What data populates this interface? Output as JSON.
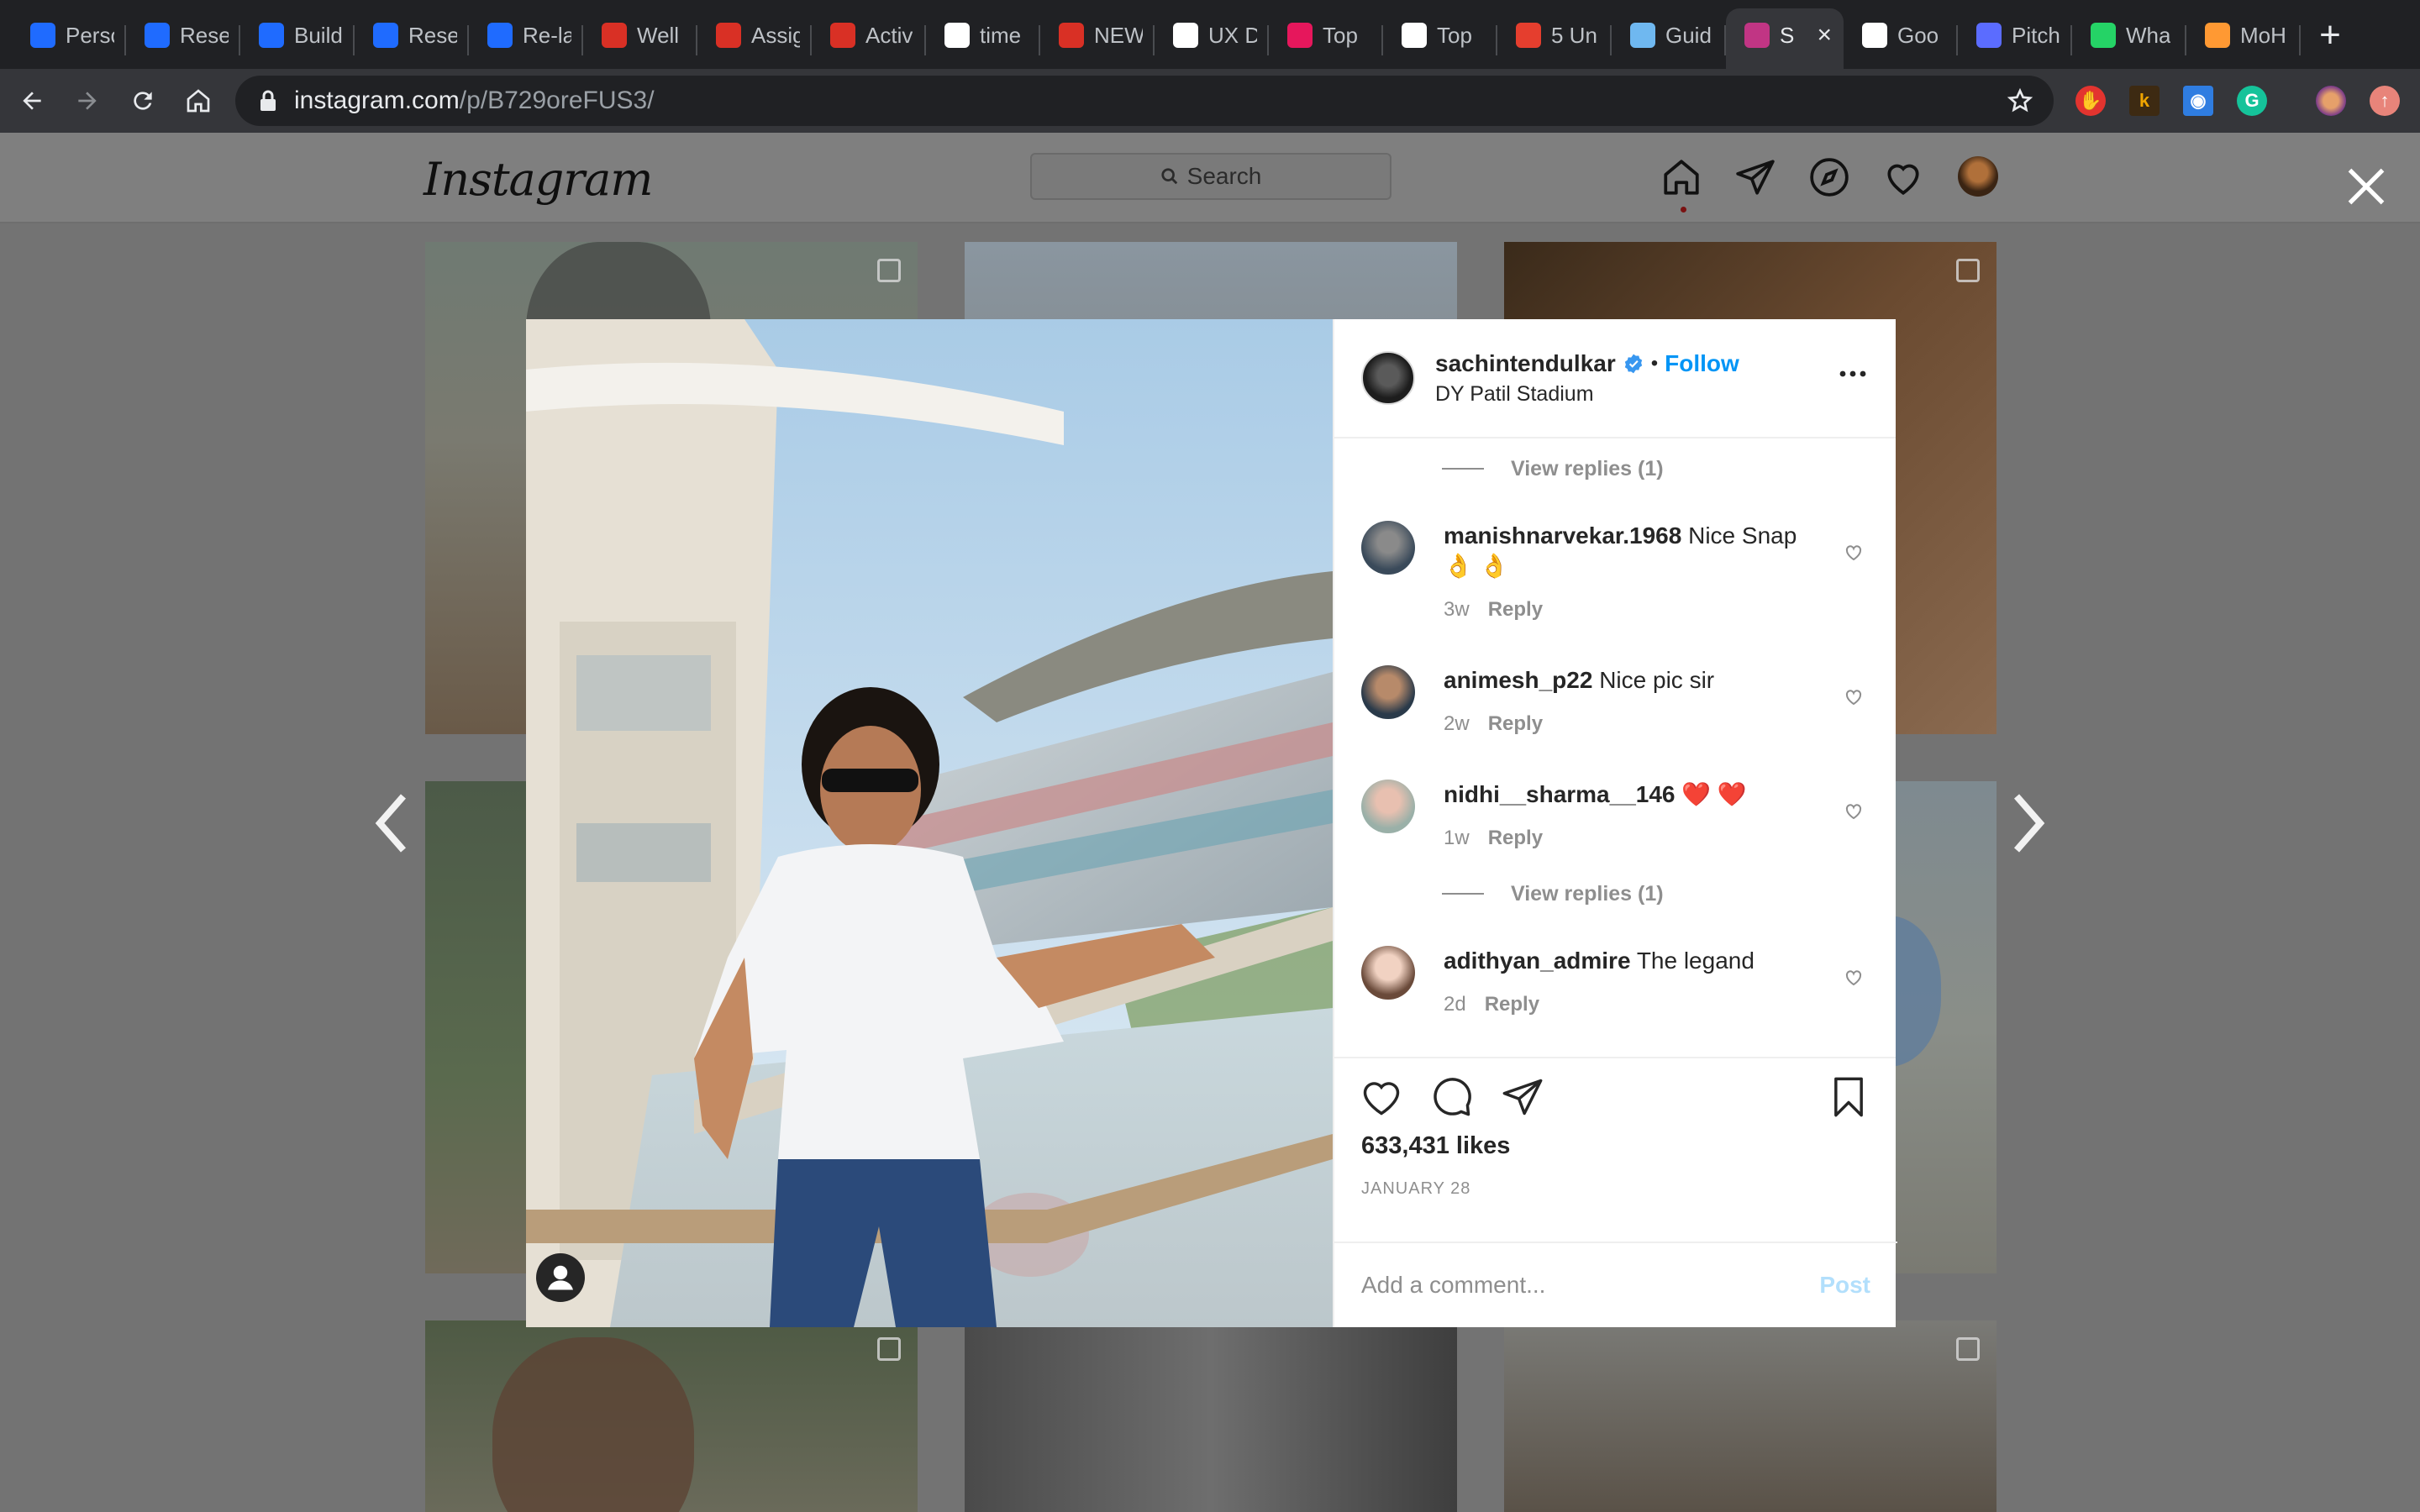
{
  "browser": {
    "tabs": [
      {
        "label": "Perso",
        "icon": "dropbox-paper-icon",
        "color": "#1f6bff"
      },
      {
        "label": "Rese",
        "icon": "dropbox-paper-icon",
        "color": "#1f6bff"
      },
      {
        "label": "Build",
        "icon": "dropbox-paper-icon",
        "color": "#1f6bff"
      },
      {
        "label": "Rese",
        "icon": "dropbox-paper-icon",
        "color": "#1f6bff"
      },
      {
        "label": "Re-la",
        "icon": "dropbox-paper-icon",
        "color": "#1f6bff"
      },
      {
        "label": "Well",
        "icon": "gmail-icon",
        "color": "#d93025"
      },
      {
        "label": "Assig",
        "icon": "gmail-icon",
        "color": "#d93025"
      },
      {
        "label": "Activ",
        "icon": "gmail-icon",
        "color": "#d93025"
      },
      {
        "label": "time",
        "icon": "google-icon",
        "color": "#ffffff"
      },
      {
        "label": "NEW",
        "icon": "gmail-icon",
        "color": "#d93025"
      },
      {
        "label": "UX D",
        "icon": "ycombinator-icon",
        "color": "#ffffff"
      },
      {
        "label": "Top",
        "icon": "medium-icon",
        "color": "#e6175c"
      },
      {
        "label": "Top",
        "icon": "document-icon",
        "color": "#ffffff"
      },
      {
        "label": "5 Un",
        "icon": "ux-icon",
        "color": "#e53e2e"
      },
      {
        "label": "Guid",
        "icon": "guide-icon",
        "color": "#6fb8f0"
      },
      {
        "label": "S",
        "icon": "instagram-icon",
        "color": "#c13584",
        "active": true
      },
      {
        "label": "Goo",
        "icon": "google-icon",
        "color": "#ffffff"
      },
      {
        "label": "Pitch",
        "icon": "pitch-icon",
        "color": "#5b6cff"
      },
      {
        "label": "Wha",
        "icon": "whatsapp-icon",
        "color": "#25d366"
      },
      {
        "label": "MoH",
        "icon": "india-flag-icon",
        "color": "#ff9933"
      }
    ],
    "url_host": "instagram.com",
    "url_path": "/p/B729oreFUS3/"
  },
  "instagram": {
    "logo": "Instagram",
    "search_placeholder": "Search"
  },
  "post": {
    "username": "sachintendulkar",
    "follow_label": "Follow",
    "separator": "•",
    "location": "DY Patil Stadium",
    "view_replies_1": "View replies (1)",
    "view_replies_2": "View replies (1)",
    "comments": [
      {
        "user": "manishnarvekar.1968",
        "text": "Nice Snap 👌 👌",
        "age": "3w",
        "reply": "Reply"
      },
      {
        "user": "animesh_p22",
        "text": "Nice pic sir",
        "age": "2w",
        "reply": "Reply"
      },
      {
        "user": "nidhi__sharma__146",
        "text": "❤️ ❤️",
        "age": "1w",
        "reply": "Reply"
      },
      {
        "user": "adithyan_admire",
        "text": "The legand",
        "age": "2d",
        "reply": "Reply"
      }
    ],
    "likes": "633,431 likes",
    "date": "JANUARY 28",
    "comment_placeholder": "Add a comment...",
    "post_label": "Post"
  },
  "colors": {
    "accent": "#0095f6",
    "post_disabled": "#b2dffc",
    "overlay": "#737373"
  }
}
